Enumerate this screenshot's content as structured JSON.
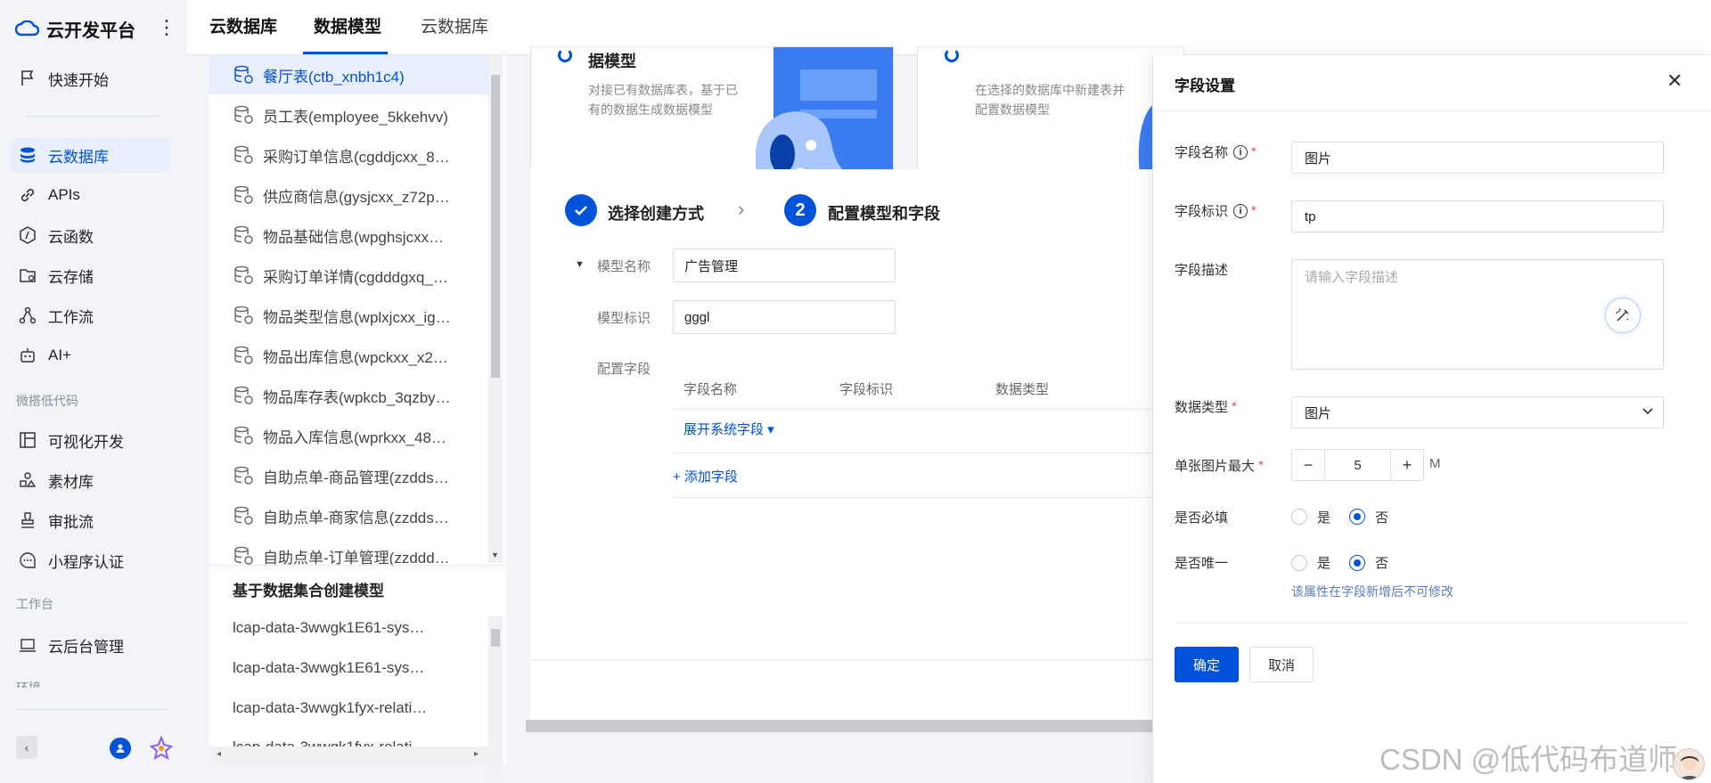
{
  "app": {
    "name": "云开发平台",
    "more_icon": "kebab-icon"
  },
  "sidebar": {
    "items_top": [
      {
        "label": "快速开始",
        "icon": "flag-icon"
      }
    ],
    "items_main": [
      {
        "label": "云数据库",
        "icon": "database-icon"
      },
      {
        "label": "APIs",
        "icon": "link-icon"
      },
      {
        "label": "云函数",
        "icon": "function-icon"
      },
      {
        "label": "云存储",
        "icon": "folder-icon"
      },
      {
        "label": "工作流",
        "icon": "workflow-icon"
      },
      {
        "label": "AI+",
        "icon": "robot-icon"
      }
    ],
    "section_lowcode": "微搭低代码",
    "items_lowcode": [
      {
        "label": "可视化开发",
        "icon": "layout-icon"
      },
      {
        "label": "素材库",
        "icon": "shapes-icon"
      },
      {
        "label": "审批流",
        "icon": "stamp-icon"
      },
      {
        "label": "小程序认证",
        "icon": "chat-icon"
      }
    ],
    "section_workbench": "工作台",
    "items_workbench": [
      {
        "label": "云后台管理",
        "icon": "laptop-icon"
      }
    ],
    "section_partial": "环境"
  },
  "topbar": {
    "title": "云数据库",
    "tabs": [
      "数据模型",
      "云数据库"
    ]
  },
  "tables": [
    "餐厅表(ctb_xnbh1c4)",
    "员工表(employee_5kkehvv)",
    "采购订单信息(cgddjcxx_8…",
    "供应商信息(gysjcxx_z72p…",
    "物品基础信息(wpghsjcxx…",
    "采购订单详情(cgdddgxq_…",
    "物品类型信息(wplxjcxx_ig…",
    "物品出库信息(wpckxx_x2…",
    "物品库存表(wpkcb_3qzby…",
    "物品入库信息(wprkxx_48…",
    "自助点单-商品管理(zzdds…",
    "自助点单-商家信息(zzdds…",
    "自助点单-订单管理(zzddd…"
  ],
  "dataset_section": {
    "title": "基于数据集合创建模型",
    "items": [
      "lcap-data-3wwgk1E61-sys…",
      "lcap-data-3wwgk1E61-sys…",
      "lcap-data-3wwgk1fyx-relati…"
    ]
  },
  "cards": {
    "left_title": "据模型",
    "left_desc_1": "对接已有数据库表，基于已",
    "left_desc_2": "有的数据生成数据模型",
    "right_desc_1": "在选择的数据库中新建表并",
    "right_desc_2": "配置数据模型"
  },
  "steps": {
    "step1": "选择创建方式",
    "step2_num": "2",
    "step2": "配置模型和字段"
  },
  "model_form": {
    "name_label": "模型名称",
    "name_value": "广告管理",
    "id_label": "模型标识",
    "id_value": "gggl",
    "fields_label": "配置字段",
    "columns": [
      "字段名称",
      "字段标识",
      "数据类型"
    ],
    "expand_link": "展开系统字段 ▾",
    "add_link": "+ 添加字段"
  },
  "drawer": {
    "title": "字段设置",
    "field_name_label": "字段名称",
    "field_name_value": "图片",
    "field_id_label": "字段标识",
    "field_id_value": "tp",
    "desc_label": "字段描述",
    "desc_placeholder": "请输入字段描述",
    "type_label": "数据类型",
    "type_value": "图片",
    "max_label": "单张图片最大",
    "max_value": "5",
    "max_unit": "M",
    "required_label": "是否必填",
    "unique_label": "是否唯一",
    "yes": "是",
    "no": "否",
    "unique_hint": "该属性在字段新增后不可修改",
    "confirm": "确定",
    "cancel": "取消"
  },
  "watermark": "CSDN @低代码布道师",
  "colors": {
    "primary": "#0052d9",
    "required": "#e34d59"
  }
}
